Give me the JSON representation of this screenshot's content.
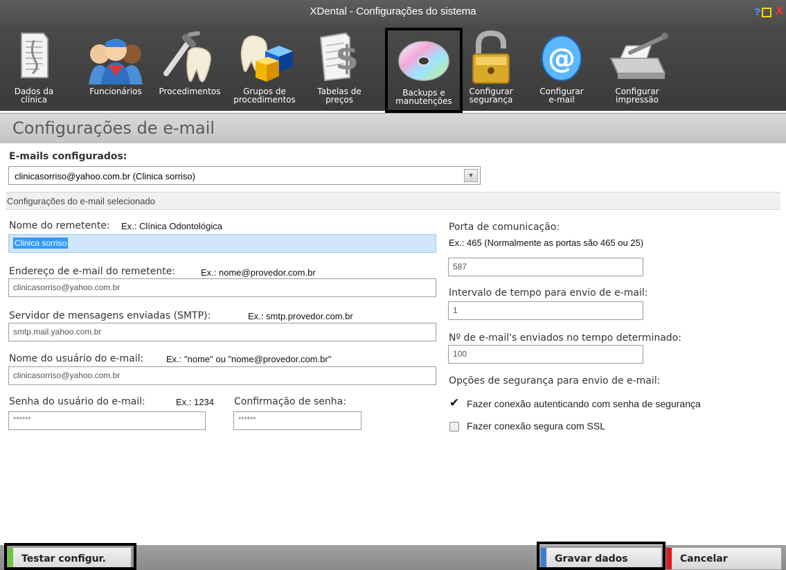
{
  "window": {
    "title": "XDental - Configurações do sistema"
  },
  "toolbar": {
    "items": [
      {
        "label": "Dados da\nclínica",
        "icon": "document-icon"
      },
      {
        "label": "Funcionários",
        "icon": "staff-icon"
      },
      {
        "label": "Procedimentos",
        "icon": "dental-tool-icon"
      },
      {
        "label": "Grupos de\nprocedimentos",
        "icon": "tooth-cubes-icon"
      },
      {
        "label": "Tabelas de\npreços",
        "icon": "price-table-icon"
      },
      {
        "label": "Backups e\nmanutenções",
        "icon": "disc-icon"
      },
      {
        "label": "Configurar\nsegurança",
        "icon": "padlock-icon"
      },
      {
        "label": "Configurar\ne-mail",
        "icon": "at-sign-icon"
      },
      {
        "label": "Configurar\nimpressão",
        "icon": "printer-icon"
      }
    ]
  },
  "section": {
    "title": "Configurações de e-mail"
  },
  "emails": {
    "label": "E-mails configurados:",
    "selected": "clinicasorriso@yahoo.com.br (Clinica sorriso)"
  },
  "subsection": {
    "title": "Configurações do e-mail selecionado"
  },
  "form": {
    "sender_name": {
      "label": "Nome do remetente:",
      "example": "Ex.: Clínica Odontológica",
      "value": "Clinica sorriso"
    },
    "sender_email": {
      "label": "Endereço de e-mail do remetente:",
      "example": "Ex.: nome@provedor.com.br",
      "value": "clinicasorriso@yahoo.com.br"
    },
    "smtp": {
      "label": "Servidor de mensagens enviadas (SMTP):",
      "example": "Ex.: smtp.provedor.com.br",
      "value": "smtp.mail.yahoo.com.br"
    },
    "username": {
      "label": "Nome do usuário do e-mail:",
      "example": "Ex.: \"nome\" ou \"nome@provedor.com.br\"",
      "value": "clinicasorriso@yahoo.com.br"
    },
    "password": {
      "label": "Senha do usuário do e-mail:",
      "example": "Ex.: 1234",
      "value": "******"
    },
    "password_confirm": {
      "label": "Confirmação de senha:",
      "value": "******"
    },
    "port": {
      "label": "Porta de comunicação:",
      "example": "Ex.: 465 (Normalmente as portas são 465 ou 25)",
      "value": "587"
    },
    "interval": {
      "label": "Intervalo de tempo para envio de e-mail:",
      "value": "1"
    },
    "count": {
      "label": "Nº de e-mail's enviados no tempo determinado:",
      "value": "100"
    },
    "security": {
      "label": "Opções de segurança para envio de e-mail:",
      "auth": {
        "label": "Fazer conexão autenticando com senha de segurança",
        "checked": true
      },
      "ssl": {
        "label": "Fazer conexão segura com SSL",
        "checked": false
      }
    }
  },
  "buttons": {
    "test": "Testar configur.",
    "save": "Gravar dados",
    "cancel": "Cancelar"
  },
  "colors": {
    "test_stripe": "#6cc644",
    "save_stripe": "#3a7fd5",
    "cancel_stripe": "#d62020"
  }
}
